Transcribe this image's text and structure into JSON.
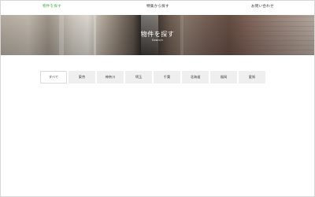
{
  "nav": {
    "items": [
      {
        "label": "物件を探す",
        "active": true
      },
      {
        "label": "特集から探す",
        "active": false
      },
      {
        "label": "お問い合わせ",
        "active": false
      }
    ]
  },
  "hero": {
    "title": "物件を探す",
    "subtitle": "Search"
  },
  "tabs": [
    {
      "label": "すべて",
      "active": true
    },
    {
      "label": "東京",
      "active": false
    },
    {
      "label": "神奈川",
      "active": false
    },
    {
      "label": "埼玉",
      "active": false
    },
    {
      "label": "千葉",
      "active": false
    },
    {
      "label": "北海道",
      "active": false
    },
    {
      "label": "福岡",
      "active": false
    },
    {
      "label": "愛知",
      "active": false
    }
  ],
  "colors": {
    "accent": "#4caf50",
    "tab_bg": "#efefef",
    "text": "#333333"
  }
}
